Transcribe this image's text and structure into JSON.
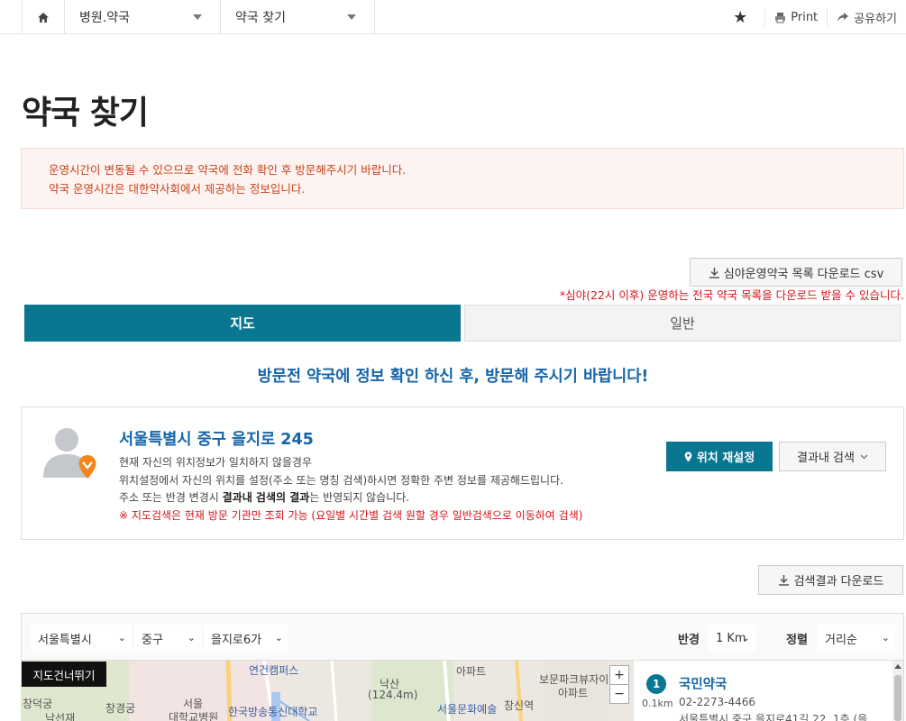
{
  "nav": {
    "menu1": "병원.약국",
    "menu2": "약국 찾기",
    "print": "Print",
    "share": "공유하기"
  },
  "page": {
    "title": "약국 찾기"
  },
  "notice": {
    "line1": "운영시간이 변동될 수 있으므로 약국에 전화 확인 후 방문해주시기 바랍니다.",
    "line2": "약국 운영시간은 대한약사회에서 제공하는 정보입니다."
  },
  "csv": {
    "button": "심야운영약국 목록 다운로드 csv",
    "note": "*심야(22시 이후) 운영하는 전국 약국 목록을 다운로드 받을 수 있습니다."
  },
  "tabs": {
    "map": "지도",
    "normal": "일반"
  },
  "guide": "방문전 약국에 정보 확인 하신 후, 방문해 주시기 바랍니다!",
  "location": {
    "address": "서울특별시 중구 을지로 245",
    "desc1": "현재 자신의 위치정보가 일치하지 않을경우",
    "desc2": "위치설정에서 자신의 위치를 설정(주소 또는 명칭 검색)하시면 정확한 주변 정보를 제공해드립니다.",
    "desc3_pre": "주소 또는 반경 변경시 ",
    "desc3_bold": "결과내 검색의 결과",
    "desc3_post": "는 반영되지 않습니다.",
    "desc4": "※ 지도검색은 현재 방문 기관만 조회 가능 (요일별 시간별 검색 원할 경우 일반검색으로 이동하여 검색)",
    "reset_button": "위치 재설정",
    "search_in_button": "결과내 검색"
  },
  "result_download": "검색결과 다운로드",
  "filters": {
    "city": "서울특별시",
    "district": "중구",
    "dong": "을지로6가",
    "radius_label": "반경",
    "radius": "1 Km",
    "sort_label": "정렬",
    "sort": "거리순"
  },
  "map": {
    "skip": "지도건너뛰기",
    "labels": [
      "연건캠퍼스",
      "아파트",
      "보문파크뷰자이",
      "아파트",
      "창덕궁",
      "창경궁",
      "서울",
      "대학교병원",
      "낙산",
      "(124.4m)",
      "서울문화예술",
      "창신역",
      "한국방송통신대학교",
      "낙선재"
    ],
    "zoom_in": "+",
    "zoom_out": "−"
  },
  "results": [
    {
      "index": "1",
      "distance": "0.1km",
      "name": "국민약국",
      "tel": "02-2273-4466",
      "address": "서울특별시 중구 을지로41길 22, 1층 (을"
    }
  ],
  "colors": {
    "primary": "#0a7791",
    "link": "#1565a8",
    "alert": "#d6141a"
  }
}
